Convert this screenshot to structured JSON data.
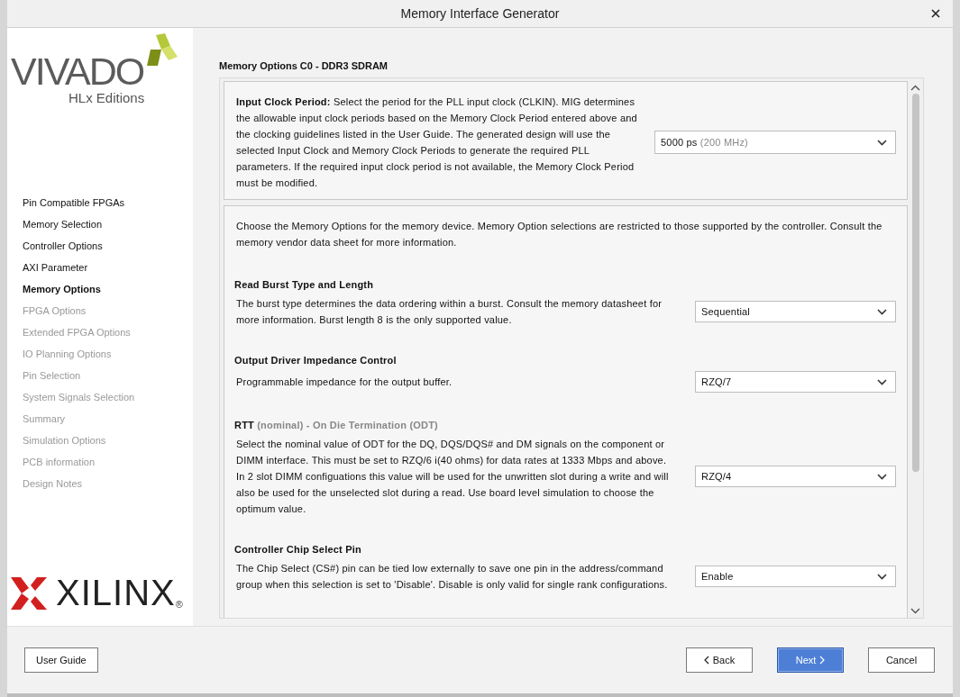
{
  "window": {
    "title": "Memory Interface Generator"
  },
  "logo": {
    "product": "VIVADO",
    "edition": "HLx Editions",
    "vendor": "XILINX",
    "vendor_mark": "®"
  },
  "steps": [
    {
      "label": "Pin Compatible FPGAs",
      "selected": false,
      "disabled": false
    },
    {
      "label": "Memory Selection",
      "selected": false,
      "disabled": false
    },
    {
      "label": "Controller Options",
      "selected": false,
      "disabled": false
    },
    {
      "label": "AXI Parameter",
      "selected": false,
      "disabled": false
    },
    {
      "label": "Memory Options",
      "selected": true,
      "disabled": false
    },
    {
      "label": "FPGA Options",
      "selected": false,
      "disabled": true
    },
    {
      "label": "Extended FPGA Options",
      "selected": false,
      "disabled": true
    },
    {
      "label": "IO Planning Options",
      "selected": false,
      "disabled": true
    },
    {
      "label": "Pin Selection",
      "selected": false,
      "disabled": true
    },
    {
      "label": "System Signals Selection",
      "selected": false,
      "disabled": true
    },
    {
      "label": "Summary",
      "selected": false,
      "disabled": true
    },
    {
      "label": "Simulation Options",
      "selected": false,
      "disabled": true
    },
    {
      "label": "PCB information",
      "selected": false,
      "disabled": true
    },
    {
      "label": "Design Notes",
      "selected": false,
      "disabled": true
    }
  ],
  "page": {
    "heading": "Memory Options C0 - DDR3 SDRAM",
    "clock": {
      "text": "**Input Clock Period:** Select the period for the PLL input clock (CLKIN). MIG determines the allowable input clock periods based on the Memory Clock Period entered above and the clocking guidelines listed in the User Guide. The generated design will use the selected Input Clock and Memory Clock Periods to generate the required PLL parameters. If the required input clock period is not available, the Memory Clock Period must be modified.",
      "value": "5000 ps",
      "value_note": "(200 MHz)"
    },
    "intro": "Choose the Memory Options for the memory device. Memory Option selections are restricted to those supported by the controller. Consult the memory vendor data sheet for more information.",
    "options": [
      {
        "title": "Read Burst Type and Length",
        "description": "The burst type determines the data ordering within a burst. Consult the memory datasheet for more information. Burst length 8 is the only supported value.",
        "value": "Sequential"
      },
      {
        "title": "Output Driver Impedance Control",
        "description": "Programmable impedance for the output buffer.",
        "value": "RZQ/7"
      },
      {
        "title": "RTT",
        "title_note": "(nominal) - On Die Termination (ODT)",
        "description": "Select the nominal value of ODT for the DQ, DQS/DQS# and DM signals on the component or DIMM interface. This must be set to RZQ/6 i(40 ohms) for data rates at 1333 Mbps and above. In 2 slot DIMM configuations this value will be used for the unwritten slot during a write and will also be used for the unselected slot during a read. Use board level simulation to choose the optimum value.",
        "value": "RZQ/4"
      },
      {
        "title": "Controller Chip Select Pin",
        "description": "The Chip Select (CS#) pin can be tied low externally to save one pin in the address/command group when this selection is set to 'Disable'. Disable is only valid for single rank configurations.",
        "value": "Enable"
      }
    ]
  },
  "buttons": {
    "help": "User Guide",
    "back": "Back",
    "next": "Next",
    "cancel": "Cancel"
  }
}
